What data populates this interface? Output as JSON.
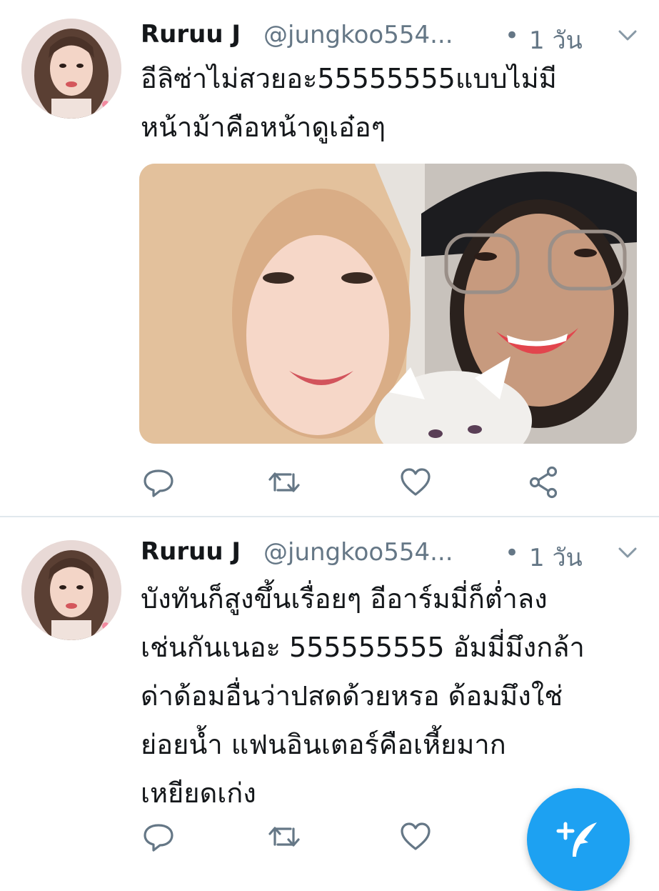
{
  "tweets": [
    {
      "author_name": "Ruruu J",
      "author_handle": "@jungkoo554...",
      "separator": "•",
      "time": "1 วัน",
      "text_lines": [
        "อีลิซ่าไม่สวยอะ55555555แบบไม่มี",
        "หน้าม้าคือหน้าดูเอ๋อๆ"
      ],
      "has_media": true
    },
    {
      "author_name": "Ruruu J",
      "author_handle": "@jungkoo554...",
      "separator": "•",
      "time": "1 วัน",
      "text_lines": [
        "บังทันก็สูงขึ้นเรื่อยๆ อีอาร์มมี่ก็ต่ำลง",
        "เช่นกันเนอะ 555555555 อัมมี่มึงกล้า",
        "ด่าด้อมอื่นว่าปสดด้วยหรอ ด้อมมึงใช่",
        "ย่อยน้ำ  แฟนอินเตอร์คือเหี้ยมาก",
        "เหยียดเก่ง"
      ],
      "has_media": false
    }
  ],
  "icons": {
    "reply": "reply-icon",
    "retweet": "retweet-icon",
    "like": "heart-icon",
    "share": "share-icon",
    "more": "chevron-down-icon",
    "compose": "compose-tweet-icon"
  },
  "colors": {
    "primary_text": "#14171a",
    "secondary_text": "#657786",
    "accent": "#1da1f2",
    "divider": "#e1e8ed"
  }
}
